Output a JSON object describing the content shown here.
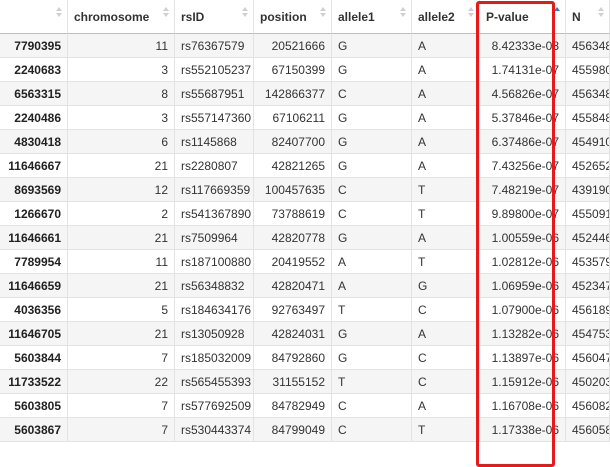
{
  "table": {
    "columns": [
      {
        "label": "",
        "sort": "none"
      },
      {
        "label": "chromosome",
        "sort": "none"
      },
      {
        "label": "rsID",
        "sort": "none"
      },
      {
        "label": "position",
        "sort": "none"
      },
      {
        "label": "allele1",
        "sort": "none"
      },
      {
        "label": "allele2",
        "sort": "none"
      },
      {
        "label": "P-value",
        "sort": "ascending"
      },
      {
        "label": "N",
        "sort": "none"
      }
    ],
    "rows": [
      [
        "7790395",
        "11",
        "rs76367579",
        "20521666",
        "G",
        "A",
        "8.42333e-08",
        "456348"
      ],
      [
        "2240683",
        "3",
        "rs552105237",
        "67150399",
        "G",
        "A",
        "1.74131e-07",
        "455980"
      ],
      [
        "6563315",
        "8",
        "rs55687951",
        "142866377",
        "C",
        "A",
        "4.56826e-07",
        "456348"
      ],
      [
        "2240486",
        "3",
        "rs557147360",
        "67106211",
        "G",
        "A",
        "5.37846e-07",
        "455848"
      ],
      [
        "4830418",
        "6",
        "rs1145868",
        "82407700",
        "G",
        "A",
        "6.37486e-07",
        "454910"
      ],
      [
        "11646667",
        "21",
        "rs2280807",
        "42821265",
        "G",
        "A",
        "7.43256e-07",
        "452652"
      ],
      [
        "8693569",
        "12",
        "rs117669359",
        "100457635",
        "C",
        "T",
        "7.48219e-07",
        "439190"
      ],
      [
        "1266670",
        "2",
        "rs541367890",
        "73788619",
        "C",
        "T",
        "9.89800e-07",
        "455091"
      ],
      [
        "11646661",
        "21",
        "rs7509964",
        "42820778",
        "G",
        "A",
        "1.00559e-06",
        "452446"
      ],
      [
        "7789954",
        "11",
        "rs187100880",
        "20419552",
        "A",
        "T",
        "1.02812e-06",
        "453579"
      ],
      [
        "11646659",
        "21",
        "rs56348832",
        "42820471",
        "A",
        "G",
        "1.06959e-06",
        "452347"
      ],
      [
        "4036356",
        "5",
        "rs184634176",
        "92763497",
        "T",
        "C",
        "1.07900e-06",
        "456189"
      ],
      [
        "11646705",
        "21",
        "rs13050928",
        "42824031",
        "G",
        "A",
        "1.13282e-06",
        "454753"
      ],
      [
        "5603844",
        "7",
        "rs185032009",
        "84792860",
        "G",
        "C",
        "1.13897e-06",
        "456047"
      ],
      [
        "11733522",
        "22",
        "rs565455393",
        "31155152",
        "T",
        "C",
        "1.15912e-06",
        "450203"
      ],
      [
        "5603805",
        "7",
        "rs577692509",
        "84782949",
        "C",
        "A",
        "1.16708e-06",
        "456082"
      ],
      [
        "5603867",
        "7",
        "rs530443374",
        "84799049",
        "C",
        "T",
        "1.17338e-06",
        "456058"
      ]
    ]
  },
  "colors": {
    "highlight_border": "#e8191a",
    "sort_active": "#337ab7",
    "row_stripe": "#f5f5f5"
  }
}
